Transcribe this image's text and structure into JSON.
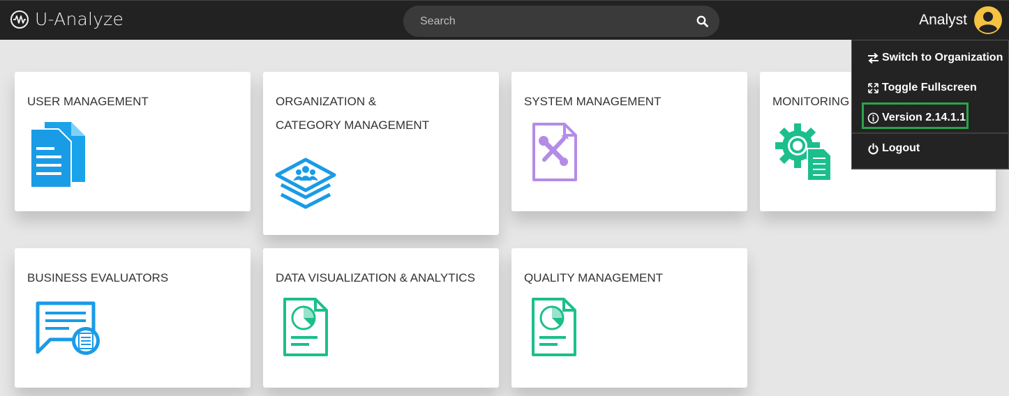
{
  "app": {
    "name": "U-Analyze"
  },
  "search": {
    "placeholder": "Search"
  },
  "user": {
    "name": "Analyst"
  },
  "dropdown": {
    "items": [
      {
        "label": "Switch to Organization",
        "icon": "swap-arrows-icon"
      },
      {
        "label": "Toggle Fullscreen",
        "icon": "expand-icon"
      },
      {
        "label": "Version 2.14.1.1",
        "icon": "info-icon"
      },
      {
        "label": "Logout",
        "icon": "power-icon"
      }
    ]
  },
  "cards": [
    {
      "title": "USER MANAGEMENT",
      "icon": "documents-icon"
    },
    {
      "title": "ORGANIZATION & CATEGORY MANAGEMENT",
      "icon": "layers-users-icon"
    },
    {
      "title": "SYSTEM MANAGEMENT",
      "icon": "tools-document-icon"
    },
    {
      "title": "MONITORING & ",
      "icon": "gear-checklist-icon"
    },
    {
      "title": "BUSINESS EVALUATORS",
      "icon": "chat-report-icon"
    },
    {
      "title": "DATA VISUALIZATION & ANALYTICS",
      "icon": "pie-report-icon"
    },
    {
      "title": "QUALITY MANAGEMENT",
      "icon": "pie-report-icon"
    }
  ],
  "colors": {
    "topbar": "#222222",
    "blue_icon": "#1a9be6",
    "purple_icon": "#b48ce6",
    "green_icon": "#1cbf8c",
    "avatar": "#f5c242",
    "highlight": "#2aa44a"
  }
}
